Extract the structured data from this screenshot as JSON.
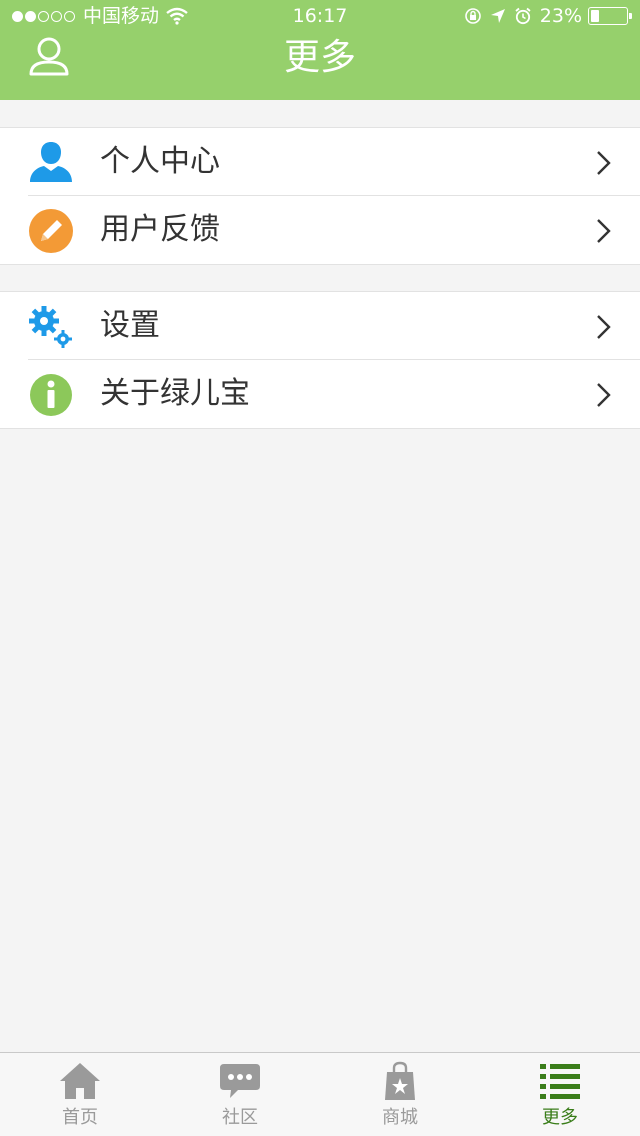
{
  "status_bar": {
    "carrier": "中国移动",
    "time": "16:17",
    "battery_percent": "23%",
    "battery_level": 0.23,
    "signal_bars": 2,
    "signal_total": 5
  },
  "nav": {
    "title": "更多",
    "left_icon": "profile-icon"
  },
  "colors": {
    "header_bg": "#96d06c",
    "blue_icon": "#1e9ae8",
    "orange_icon": "#f39a36",
    "green_icon": "#8cc85a",
    "active_tab": "#3a7d1a",
    "inactive_tab": "#9a9a9a"
  },
  "menu": {
    "group1": [
      {
        "label": "个人中心",
        "icon": "person-icon"
      },
      {
        "label": "用户反馈",
        "icon": "feedback-pencil-icon"
      }
    ],
    "group2": [
      {
        "label": "设置",
        "icon": "gears-icon"
      },
      {
        "label": "关于绿儿宝",
        "icon": "info-icon"
      }
    ]
  },
  "tabs": [
    {
      "label": "首页",
      "icon": "home-icon",
      "active": false
    },
    {
      "label": "社区",
      "icon": "chat-bubble-icon",
      "active": false
    },
    {
      "label": "商城",
      "icon": "shopping-bag-icon",
      "active": false
    },
    {
      "label": "更多",
      "icon": "list-icon",
      "active": true
    }
  ]
}
